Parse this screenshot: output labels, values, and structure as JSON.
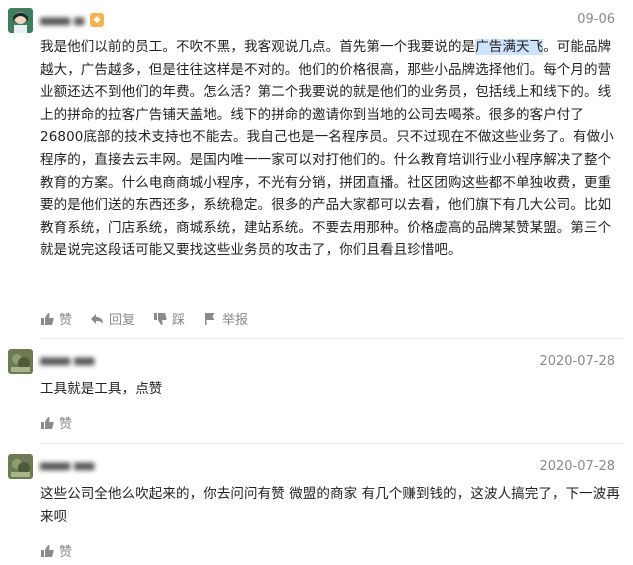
{
  "comments": [
    {
      "user": "▄▄▄ ▄",
      "date": "09-06",
      "text_before": "我是他们以前的员工。不吹不黑，我客观说几点。首先第一个我要说的是",
      "text_highlight": "广告满天飞",
      "text_after": "。可能品牌越大，广告越多，但是往往这样是不对的。他们的价格很高，那些小品牌选择他们。每个月的营业额还达不到他们的年费。怎么活？第二个我要说的就是他们的业务员，包括线上和线下的。线上的拼命的拉客广告铺天盖地。线下的拼命的邀请你到当地的公司去喝茶。很多的客户付了26800底部的技术支持也不能去。我自己也是一名程序员。只不过现在不做这些业务了。有做小程序的，直接去云丰网。是国内唯一一家可以对打他们的。什么教育培训行业小程序解决了整个教育的方案。什么电商商城小程序，不光有分销，拼团直播。社区团购这些都不单独收费，更重要的是他们送的东西还多，系统稳定。很多的产品大家都可以去看，他们旗下有几大公司。比如教育系统，门店系统，商城系统，建站系统。不要去用那种。价格虚高的品牌某赞某盟。第三个就是说完这段话可能又要找这些业务员的攻击了，你们且看且珍惜吧。",
      "actions": {
        "like": "赞",
        "reply": "回复",
        "dislike": "踩",
        "report": "举报"
      }
    },
    {
      "user": "▄▄▄ ▄▄",
      "date": "2020-07-28",
      "text": "工具就是工具，点赞",
      "actions": {
        "like": "赞"
      }
    },
    {
      "user": "▄▄▄ ▄▄",
      "date": "2020-07-28",
      "text": "这些公司全他么吹起来的，你去问问有赞 微盟的商家 有几个赚到钱的，这波人搞完了，下一波再来呗",
      "actions": {
        "like": "赞"
      }
    }
  ],
  "colors": {
    "meta": "#8a8a8a",
    "text": "#222222",
    "highlight": "#cfe3fb",
    "badge": "#f2b451"
  },
  "icons": [
    "thumbs-up-icon",
    "reply-icon",
    "thumbs-down-icon",
    "flag-icon",
    "level-badge-icon"
  ]
}
